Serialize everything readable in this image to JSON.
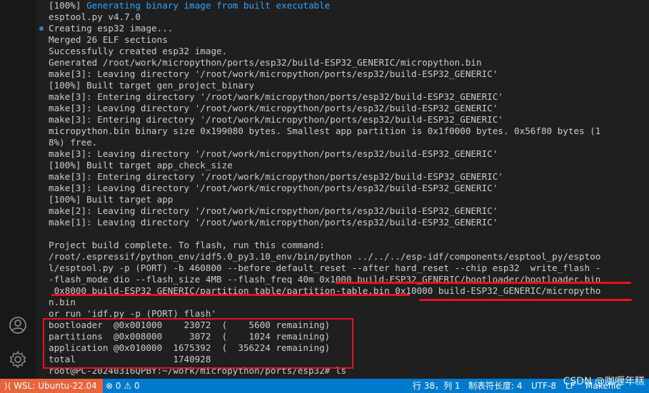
{
  "terminal_lines": [
    {
      "prefix": "[100%] ",
      "text": "Generating binary image from built executable",
      "highlight": true
    },
    {
      "text": "esptool.py v4.7.0"
    },
    {
      "text": "Creating esp32 image...",
      "dot": true
    },
    {
      "text": "Merged 26 ELF sections"
    },
    {
      "text": "Successfully created esp32 image."
    },
    {
      "text": "Generated /root/work/micropython/ports/esp32/build-ESP32_GENERIC/micropython.bin"
    },
    {
      "text": "make[3]: Leaving directory '/root/work/micropython/ports/esp32/build-ESP32_GENERIC'"
    },
    {
      "text": "[100%] Built target gen_project_binary"
    },
    {
      "text": "make[3]: Entering directory '/root/work/micropython/ports/esp32/build-ESP32_GENERIC'"
    },
    {
      "text": "make[3]: Leaving directory '/root/work/micropython/ports/esp32/build-ESP32_GENERIC'"
    },
    {
      "text": "make[3]: Entering directory '/root/work/micropython/ports/esp32/build-ESP32_GENERIC'"
    },
    {
      "text": "micropython.bin binary size 0x199080 bytes. Smallest app partition is 0x1f0000 bytes. 0x56f80 bytes (1"
    },
    {
      "text": "8%) free."
    },
    {
      "text": "make[3]: Leaving directory '/root/work/micropython/ports/esp32/build-ESP32_GENERIC'"
    },
    {
      "text": "[100%] Built target app_check_size"
    },
    {
      "text": "make[3]: Entering directory '/root/work/micropython/ports/esp32/build-ESP32_GENERIC'"
    },
    {
      "text": "make[3]: Leaving directory '/root/work/micropython/ports/esp32/build-ESP32_GENERIC'"
    },
    {
      "text": "[100%] Built target app"
    },
    {
      "text": "make[2]: Leaving directory '/root/work/micropython/ports/esp32/build-ESP32_GENERIC'"
    },
    {
      "text": "make[1]: Leaving directory '/root/work/micropython/ports/esp32/build-ESP32_GENERIC'"
    },
    {
      "text": ""
    },
    {
      "text": "Project build complete. To flash, run this command:"
    },
    {
      "text": "/root/.espressif/python_env/idf5.0_py3.10_env/bin/python ../../../esp-idf/components/esptool_py/esptoo"
    },
    {
      "text": "l/esptool.py -p (PORT) -b 460800 --before default_reset --after hard_reset --chip esp32  write_flash -"
    },
    {
      "text": "-flash_mode dio --flash_size 4MB --flash_freq 40m 0x1000 build-ESP32_GENERIC/bootloader/bootloader.bin"
    },
    {
      "text": " 0x8000 build-ESP32_GENERIC/partition_table/partition-table.bin 0x10000 build-ESP32_GENERIC/micropytho"
    },
    {
      "text": "n.bin"
    },
    {
      "text": "or run 'idf.py -p (PORT) flash'"
    },
    {
      "text": "bootloader  @0x001000    23072  (    5600 remaining)"
    },
    {
      "text": "partitions  @0x008000     3072  (    1024 remaining)"
    },
    {
      "text": "application @0x010000  1675392  (  356224 remaining)"
    },
    {
      "text": "total                  1740928"
    },
    {
      "text": "root@PC-20240316QPBY:~/work/micropython/ports/esp32# ls"
    }
  ],
  "activity_bar": {
    "icons": [
      "account-icon",
      "settings-gear-icon"
    ]
  },
  "status_bar": {
    "remote": "WSL: Ubuntu-22.04",
    "problems_errors": "0",
    "problems_warnings": "0",
    "cursor_position": "行 38，列 1",
    "indentation": "制表符长度: 4",
    "encoding": "UTF-8",
    "eol": "LF",
    "language": "Makefile"
  },
  "watermark": "CSDN @咖喱年糕",
  "colors": {
    "terminal_bg": "#1f1f1f",
    "terminal_text": "#cccccc",
    "highlight": "#2aa6ff",
    "annotation_red": "#e81123",
    "statusbar_bg": "#007acc",
    "remote_bg": "#e8643c"
  }
}
